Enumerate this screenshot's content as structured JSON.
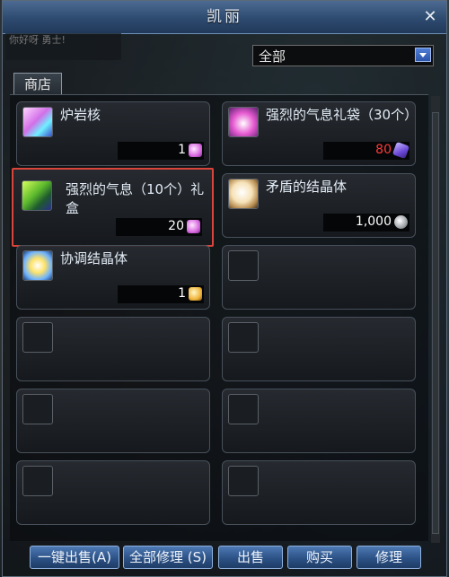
{
  "window": {
    "title": "凯丽",
    "npc_line": "你好呀 勇士!"
  },
  "filter": {
    "selected": "全部"
  },
  "tab": {
    "label": "商店"
  },
  "items": [
    {
      "name": "炉岩核",
      "price": "1",
      "price_color": "#ffffff",
      "icon": "lava-core-icon",
      "currency_icon": "pink-gem-icon"
    },
    {
      "name": "强烈的气息礼袋（30个）",
      "price": "80",
      "price_color": "#ff3a3a",
      "icon": "gift-bag-icon",
      "currency_icon": "violet-crystal-icon"
    },
    {
      "name": "强烈的气息（10个）礼盒",
      "price": "20",
      "price_color": "#ffffff",
      "icon": "gift-box-icon",
      "currency_icon": "pink-gem-icon"
    },
    {
      "name": "矛盾的结晶体",
      "price": "1,000",
      "price_color": "#ffffff",
      "icon": "crystal-icon",
      "currency_icon": "silver-coin-icon"
    },
    {
      "name": "协调结晶体",
      "price": "1",
      "price_color": "#ffffff",
      "icon": "harmony-crystal-icon",
      "currency_icon": "gold-crystal-icon"
    }
  ],
  "buttons": {
    "sell_all": "一键出售(A)",
    "repair_all": "全部修理 (S)",
    "sell": "出售",
    "buy": "购买",
    "repair": "修理"
  },
  "colors": {
    "accent": "#2a4f82",
    "selection": "#d9443b",
    "price_red": "#ff3a3a"
  }
}
